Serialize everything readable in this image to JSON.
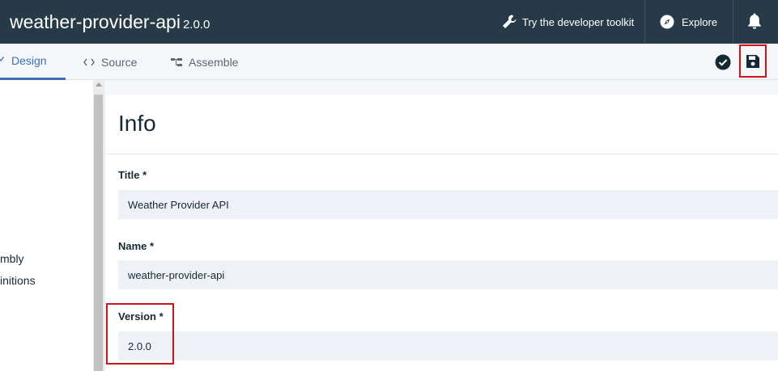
{
  "header": {
    "title": "weather-provider-api",
    "version": "2.0.0",
    "toolkit_label": "Try the developer toolkit",
    "explore_label": "Explore",
    "icons": {
      "toolkit": "wrench-icon",
      "explore": "compass-icon",
      "notifications": "bell-icon"
    }
  },
  "tabs": [
    {
      "label": "Design",
      "icon": "design-icon",
      "active": true
    },
    {
      "label": "Source",
      "icon": "code-icon",
      "active": false
    },
    {
      "label": "Assemble",
      "icon": "assemble-icon",
      "active": false
    }
  ],
  "toolbar": {
    "validate_icon": "checkmark-circle-icon",
    "save_icon": "save-icon"
  },
  "sidebar": {
    "items": [
      {
        "label": "mbly"
      },
      {
        "label": "initions"
      }
    ]
  },
  "info": {
    "title": "Info",
    "fields": {
      "title": {
        "label": "Title *",
        "value": "Weather Provider API"
      },
      "name": {
        "label": "Name *",
        "value": "weather-provider-api"
      },
      "version": {
        "label": "Version *",
        "value": "2.0.0"
      }
    }
  },
  "colors": {
    "header_bg": "#273a47",
    "accent": "#3d70b2",
    "highlight": "#d0121b",
    "input_bg": "#eef1f6"
  }
}
